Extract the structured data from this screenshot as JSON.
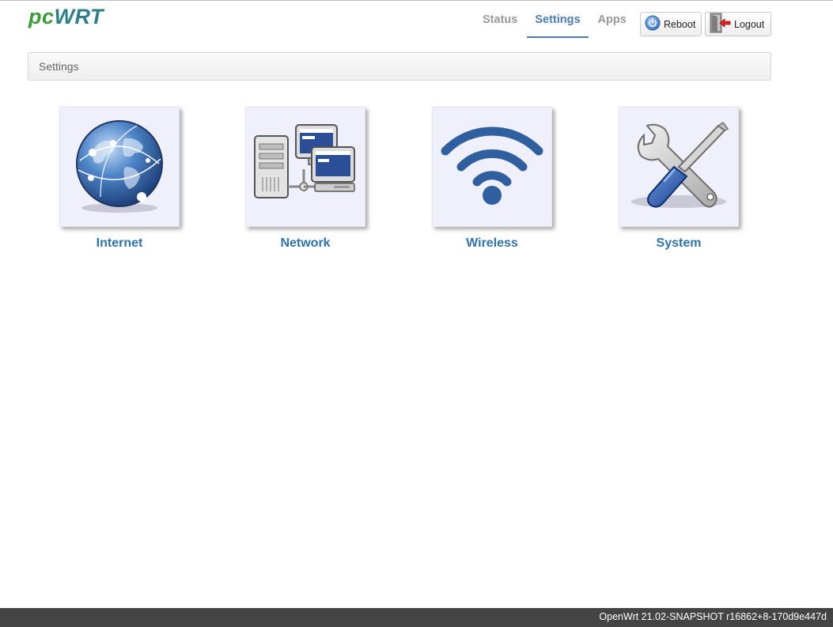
{
  "logo": {
    "part1": "pc",
    "part2": "WRT"
  },
  "nav": {
    "items": [
      {
        "label": "Status",
        "active": false
      },
      {
        "label": "Settings",
        "active": true
      },
      {
        "label": "Apps",
        "active": false
      }
    ]
  },
  "buttons": {
    "reboot_label": "Reboot",
    "logout_label": "Logout"
  },
  "breadcrumb": {
    "text": "Settings"
  },
  "tiles": [
    {
      "label": "Internet",
      "icon": "globe-icon"
    },
    {
      "label": "Network",
      "icon": "network-computers-icon"
    },
    {
      "label": "Wireless",
      "icon": "wifi-icon"
    },
    {
      "label": "System",
      "icon": "tools-icon"
    }
  ],
  "footer": {
    "text": "OpenWrt 21.02-SNAPSHOT r16862+8-170d9e447d"
  },
  "colors": {
    "accent": "#4a7bb5",
    "tile_bg": "#eef0fc",
    "tile_label": "#2f73ad",
    "logo_green": "#3f9a3a",
    "logo_teal": "#2f7f86",
    "footer_bg": "#444444"
  }
}
